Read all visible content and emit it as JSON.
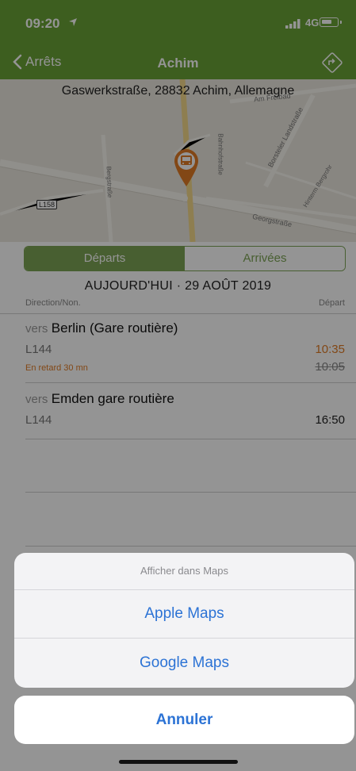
{
  "status": {
    "time": "09:20",
    "network": "4G"
  },
  "nav": {
    "back_label": "Arrêts",
    "title": "Achim"
  },
  "map": {
    "address": "Gaswerkstraße, 28832 Achim, Allemagne",
    "street_labels": [
      "Am Freibad",
      "Borsteler Landstraße",
      "Georgstraße",
      "Bahnhofstraße",
      "Hinterm Bergrohr",
      "Bergstraße",
      "L158"
    ]
  },
  "tabs": {
    "departures": "Départs",
    "arrivals": "Arrivées"
  },
  "date_header": "AUJOURD'HUI  ·  29 AOÛT 2019",
  "columns": {
    "direction": "Direction/Non.",
    "departure": "Départ"
  },
  "departures": [
    {
      "vers": "vers",
      "destination": "Berlin (Gare routière)",
      "line": "L144",
      "delay": "En retard 30 mn",
      "time": "10:35",
      "scheduled": "10:05"
    },
    {
      "vers": "vers",
      "destination": "Emden gare routière",
      "line": "L144",
      "time": "16:50"
    }
  ],
  "action_sheet": {
    "title": "Afficher dans Maps",
    "options": [
      "Apple Maps",
      "Google Maps"
    ],
    "cancel": "Annuler"
  },
  "colors": {
    "brand_green": "#69a236",
    "accent_orange": "#e07b25",
    "action_blue": "#2c73d5"
  }
}
